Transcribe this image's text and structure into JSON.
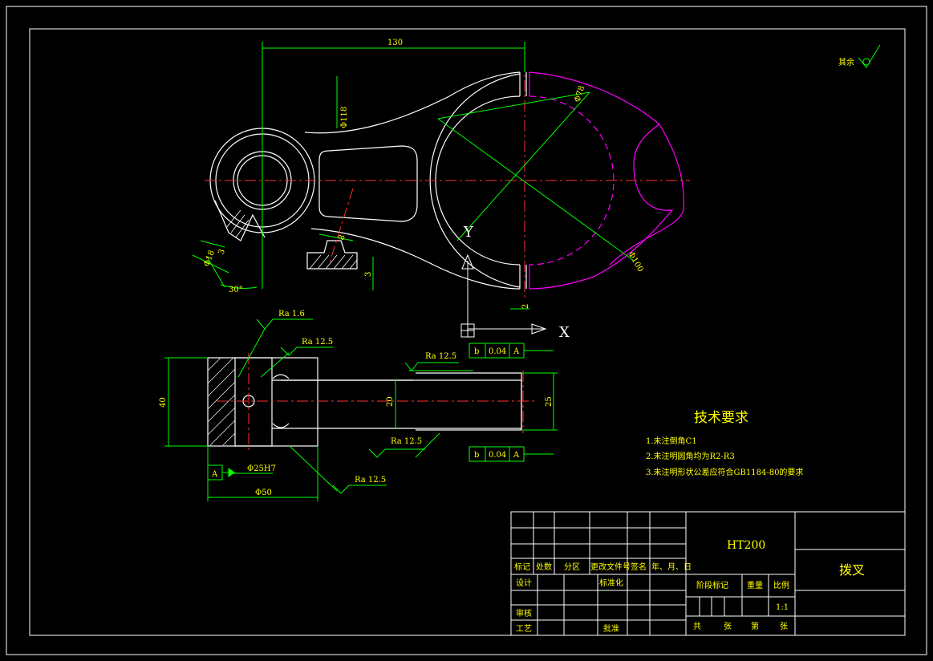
{
  "dimensions": {
    "length_130": "130",
    "dia_118": "Φ118",
    "dia_78": "Φ78",
    "dia_100": "Φ100",
    "dia_18": "Φ18",
    "angle_30": "30°",
    "dim_3": "3",
    "dim_8": "8",
    "dim_2": "2",
    "height_40": "40",
    "height_20": "20",
    "height_25": "25",
    "dia_50": "Φ50",
    "bore_25H7": "Φ25H7"
  },
  "surface_finish": {
    "ra_1_6": "Ra 1.6",
    "ra_12_5_a": "Ra 12.5",
    "ra_12_5_b": "Ra 12.5",
    "ra_12_5_c": "Ra 12.5",
    "ra_12_5_d": "Ra 12.5",
    "others": "其余"
  },
  "tolerance": {
    "top": {
      "symbol": "b",
      "value": "0.04",
      "datum": "A"
    },
    "bottom": {
      "symbol": "b",
      "value": "0.04",
      "datum": "A"
    },
    "datum_label": "A"
  },
  "axes": {
    "x": "X",
    "y": "Y"
  },
  "notes": {
    "title": "技术要求",
    "items": [
      "1.未注倒角C1",
      "2.未注明圆角均为R2-R3",
      "3.未注明形状公差应符合GB1184-80的要求"
    ]
  },
  "title_block": {
    "material": "HT200",
    "part_name": "拨叉",
    "row_headers": [
      "标记",
      "处数",
      "分区",
      "更改文件号",
      "签名",
      "年、月、日"
    ],
    "design": "设计",
    "standardize": "标准化",
    "review": "审核",
    "process": "工艺",
    "approve": "批准",
    "stage_mark": "阶段标记",
    "weight": "重量",
    "scale_label": "比例",
    "scale_value": "1:1",
    "total": "共",
    "sheets": "张",
    "page": "第",
    "sheet": "张"
  },
  "colors": {
    "background": "#000000",
    "outline": "#ffffff",
    "dimension": "#00ff00",
    "centerline": "#ff0000",
    "hidden": "#ff00ff",
    "text": "#ffff00"
  }
}
